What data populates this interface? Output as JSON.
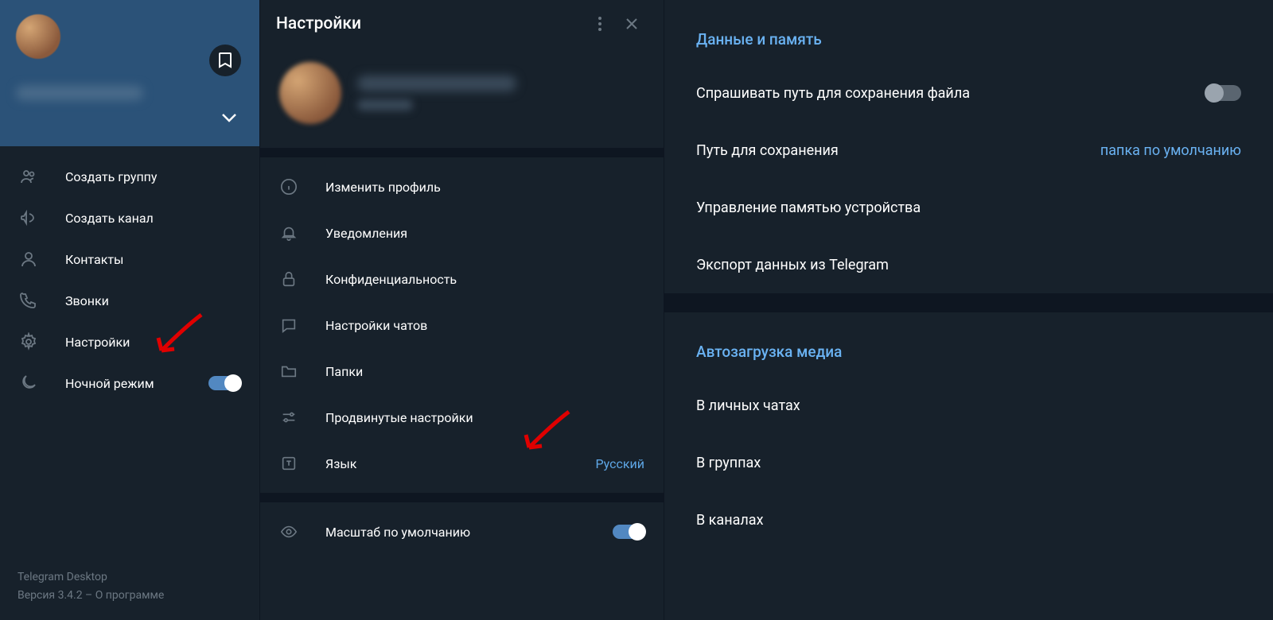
{
  "sidebar": {
    "menu": [
      {
        "icon": "group-icon",
        "label": "Создать группу"
      },
      {
        "icon": "megaphone-icon",
        "label": "Создать канал"
      },
      {
        "icon": "person-icon",
        "label": "Контакты"
      },
      {
        "icon": "phone-icon",
        "label": "Звонки"
      },
      {
        "icon": "gear-icon",
        "label": "Настройки"
      },
      {
        "icon": "moon-icon",
        "label": "Ночной режим"
      }
    ],
    "footer_app": "Telegram Desktop",
    "footer_version": "Версия 3.4.2 – О программе"
  },
  "settings": {
    "title": "Настройки",
    "items": [
      {
        "icon": "info-icon",
        "label": "Изменить профиль"
      },
      {
        "icon": "bell-icon",
        "label": "Уведомления"
      },
      {
        "icon": "lock-icon",
        "label": "Конфиденциальность"
      },
      {
        "icon": "chat-icon",
        "label": "Настройки чатов"
      },
      {
        "icon": "folder-icon",
        "label": "Папки"
      },
      {
        "icon": "sliders-icon",
        "label": "Продвинутые настройки"
      },
      {
        "icon": "language-icon",
        "label": "Язык",
        "value": "Русский"
      }
    ],
    "zoom_label": "Масштаб по умолчанию"
  },
  "right": {
    "section1_title": "Данные и память",
    "section1_items": [
      {
        "label": "Спрашивать путь для сохранения файла",
        "toggle": true
      },
      {
        "label": "Путь для сохранения",
        "value": "папка по умолчанию"
      },
      {
        "label": "Управление памятью устройства"
      },
      {
        "label": "Экспорт данных из Telegram"
      }
    ],
    "section2_title": "Автозагрузка медиа",
    "section2_items": [
      {
        "label": "В личных чатах"
      },
      {
        "label": "В группах"
      },
      {
        "label": "В каналах"
      }
    ]
  }
}
